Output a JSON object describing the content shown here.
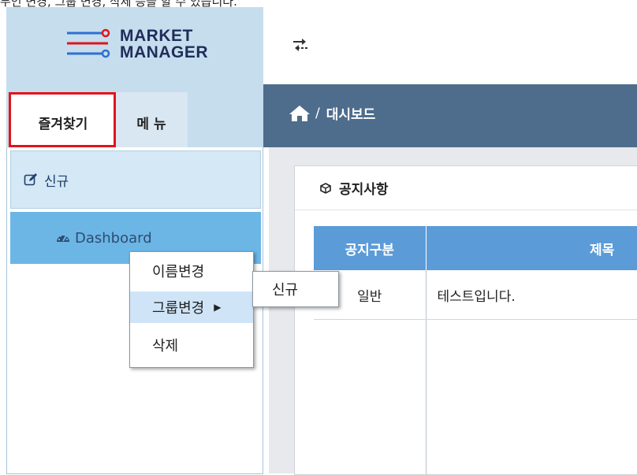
{
  "caption": "무인 변경, 그룹 변경, 삭제 등을 할 수 있습니다.",
  "logo": {
    "line1": "MARKET",
    "line2": "MANAGER",
    "icon": "circuit-lines-logo",
    "color": "#1f2d5a",
    "accent": "#e0151b"
  },
  "topbar": {
    "icon": "swap-arrows-icon"
  },
  "tabs": [
    {
      "label": "즐겨찾기",
      "active": true
    },
    {
      "label": "메 뉴",
      "active": false
    }
  ],
  "favorites": {
    "group": {
      "label": "신규",
      "icon": "edit-icon"
    },
    "item": {
      "label": "Dashboard",
      "icon": "dashboard-icon"
    }
  },
  "breadcrumb": {
    "icon": "home-icon",
    "separator": "/",
    "current": "대시보드"
  },
  "notice": {
    "title": "공지사항",
    "icon": "cube-icon",
    "columns": [
      "공지구분",
      "제목"
    ],
    "rows": [
      {
        "type": "일반",
        "title": "테스트입니다."
      }
    ]
  },
  "context_menu": {
    "items": [
      {
        "label": "이름변경"
      },
      {
        "label": "그룹변경",
        "has_submenu": true
      },
      {
        "label": "삭제"
      }
    ],
    "submenu": {
      "items": [
        "신규"
      ]
    }
  },
  "colors": {
    "sidebar_bg": "#c6ddee",
    "crumb_bar": "#4e6d8c",
    "table_header": "#5b9bd8",
    "selected_item": "#6cb6e6",
    "highlight_border": "#e0151b"
  }
}
